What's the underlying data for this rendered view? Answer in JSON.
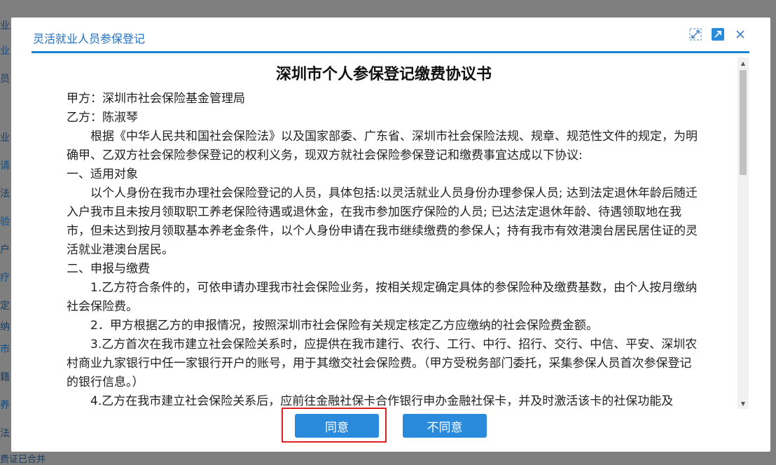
{
  "background": {
    "side_labels": [
      "业人",
      "业",
      "员",
      "",
      "业",
      "请",
      "法",
      "验",
      "户",
      "疗",
      "定",
      "纳",
      "市",
      "籍",
      "养",
      "法"
    ],
    "bottom_text": "费证已合并"
  },
  "modal": {
    "title": "灵活就业人员参保登记",
    "icons": [
      "fit-icon",
      "open-external-icon",
      "close-icon"
    ]
  },
  "document": {
    "title": "深圳市个人参保登记缴费协议书",
    "party_a": "甲方：深圳市社会保险基金管理局",
    "party_b": "乙方：陈淑琴",
    "intro": "根据《中华人民共和国社会保险法》以及国家部委、广东省、深圳市社会保险法规、规章、规范性文件的规定，为明确甲、乙双方社会保险参保登记的权利义务，现双方就社会保险参保登记和缴费事宜达成以下协议:",
    "section1_title": "一、适用对象",
    "section1_body": "以个人身份在我市办理社会保险登记的人员，具体包括:以灵活就业人员身份办理参保人员; 达到法定退休年龄后随迁入户我市且未按月领取职工养老保险待遇或退休金，在我市参加医疗保险的人员; 已达法定退休年龄、待遇领取地在我市，但未达到按月领取基本养老金条件，以个人身份申请在我市继续缴费的参保人；持有我市有效港澳台居民居住证的灵活就业港澳台居民。",
    "section2_title": "二、申报与缴费",
    "item1": "1.乙方符合条件的，可依申请办理我市社会保险业务，按相关规定确定具体的参保险种及缴费基数，由个人按月缴纳社会保险费。",
    "item2": "2．甲方根据乙方的申报情况，按照深圳市社会保险有关规定核定乙方应缴纳的社会保险费金额。",
    "item3": "3.乙方首次在我市建立社会保险关系时，应提供在我市建行、农行、工行、中行、招行、交行、中信、平安、深圳农村商业九家银行中任一家银行开户的账号，用于其缴交社会保险费。（甲方受税务部门委托，采集参保人员首次参保登记的银行信息。）",
    "item4": "4.乙方在我市建立社会保险关系后，应前往金融社保卡合作银行申办金融社保卡，并及时激活该卡的社保功能及"
  },
  "buttons": {
    "agree": "同意",
    "disagree": "不同意"
  },
  "colors": {
    "accent": "#1a83d3",
    "button": "#2a8bdc",
    "highlight": "#e02020",
    "overlay": "#7f7f7f"
  }
}
